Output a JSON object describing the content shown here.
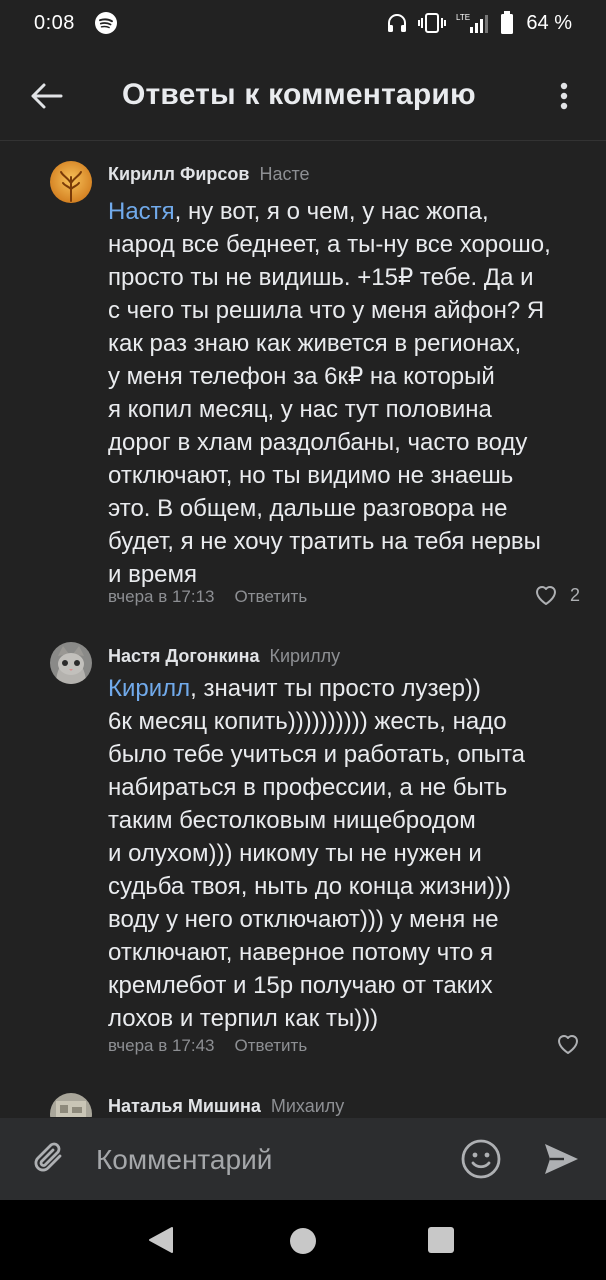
{
  "status_bar": {
    "time": "0:08",
    "network": "LTE",
    "battery": "64 %"
  },
  "header": {
    "title": "Ответы к комментарию"
  },
  "comments": [
    {
      "author": "Кирилл Фирсов",
      "reply_to": "Насте",
      "mention": "Настя",
      "text": ", ну вот, я о чем, у нас жопа,\nнарод все беднеет, а ты-ну все хорошо,\nпросто ты не видишь. +15₽ тебе. Да и\nс чего ты решила что у меня айфон? Я\nкак раз знаю как живется в регионах,\nу меня телефон за 6к₽ на который\nя копил месяц, у нас тут половина\nдорог в хлам раздолбаны, часто воду\nотключают, но ты видимо не знаешь\nэто. В общем, дальше разговора не\nбудет, я не хочу тратить на тебя нервы\nи время",
      "time": "вчера в 17:13",
      "reply_label": "Ответить",
      "likes": "2"
    },
    {
      "author": "Настя Догонкина",
      "reply_to": "Кириллу",
      "mention": "Кирилл",
      "text": ", значит ты просто лузер))\n6к месяц копить)))))))))) жесть, надо\nбыло тебе учиться и работать, опыта\nнабираться в профессии,  а не быть\nтаким бестолковым нищебродом\nи олухом))) никому ты не нужен и\nсудьба твоя, ныть до конца жизни)))\nводу у него отключают))) у меня не\nотключают, наверное потому что я\nкремлебот и 15р получаю от таких\nлохов и терпил как ты)))",
      "time": "вчера в 17:43",
      "reply_label": "Ответить",
      "likes": ""
    },
    {
      "author": "Наталья Мишина",
      "reply_to": "Михаилу"
    }
  ],
  "composer": {
    "placeholder": "Комментарий"
  },
  "colors": {
    "background": "#222222",
    "mention": "#71aaeb",
    "secondary_text": "#8d8f93"
  }
}
